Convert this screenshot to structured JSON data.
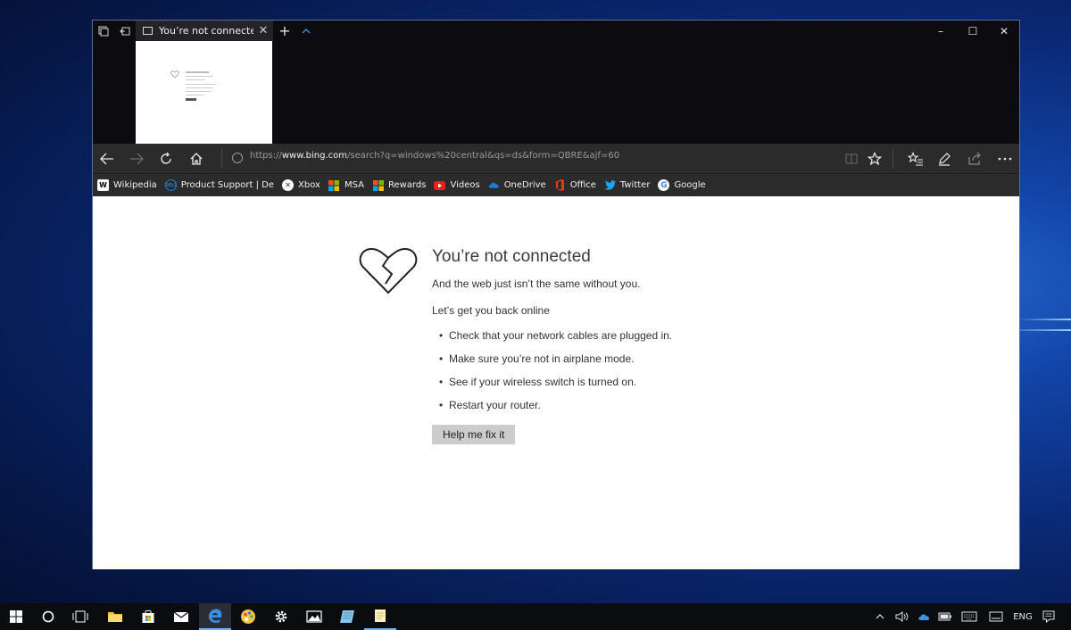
{
  "window": {
    "tab_title": "You’re not connected",
    "minimize": "–",
    "maximize": "☐",
    "close": "✕"
  },
  "navbar": {
    "url_prefix": "https://",
    "url_host": "www.bing.com",
    "url_path": "/search?q=windows%20central&qs=ds&form=QBRE&ajf=60"
  },
  "favorites": [
    {
      "label": "Wikipedia",
      "icon": "wikipedia-icon",
      "color": "#ffffff"
    },
    {
      "label": "Product Support | De",
      "icon": "dell-icon",
      "color": "#1a7bd4"
    },
    {
      "label": "Xbox",
      "icon": "xbox-icon",
      "color": "#ffffff"
    },
    {
      "label": "MSA",
      "icon": "microsoft-icon",
      "color": "#f25022"
    },
    {
      "label": "Rewards",
      "icon": "microsoft-icon",
      "color": "#f25022"
    },
    {
      "label": "Videos",
      "icon": "youtube-icon",
      "color": "#e62117"
    },
    {
      "label": "OneDrive",
      "icon": "onedrive-icon",
      "color": "#1e7ad8"
    },
    {
      "label": "Office",
      "icon": "office-icon",
      "color": "#eb3c00"
    },
    {
      "label": "Twitter",
      "icon": "twitter-icon",
      "color": "#1da1f2"
    },
    {
      "label": "Google",
      "icon": "google-icon",
      "color": "#ffffff"
    }
  ],
  "error": {
    "title": "You’re not connected",
    "subtitle": "And the web just isn’t the same without you.",
    "lead": "Let’s get you back online",
    "bullets": [
      "Check that your network cables are plugged in.",
      "Make sure you’re not in airplane mode.",
      "See if your wireless switch is turned on.",
      "Restart your router."
    ],
    "button": "Help me fix it"
  },
  "taskbar": {
    "language": "ENG"
  },
  "colors": {
    "accent": "#4aa3ff",
    "chrome": "#2b2b2b",
    "button_gray": "#cccccc"
  }
}
